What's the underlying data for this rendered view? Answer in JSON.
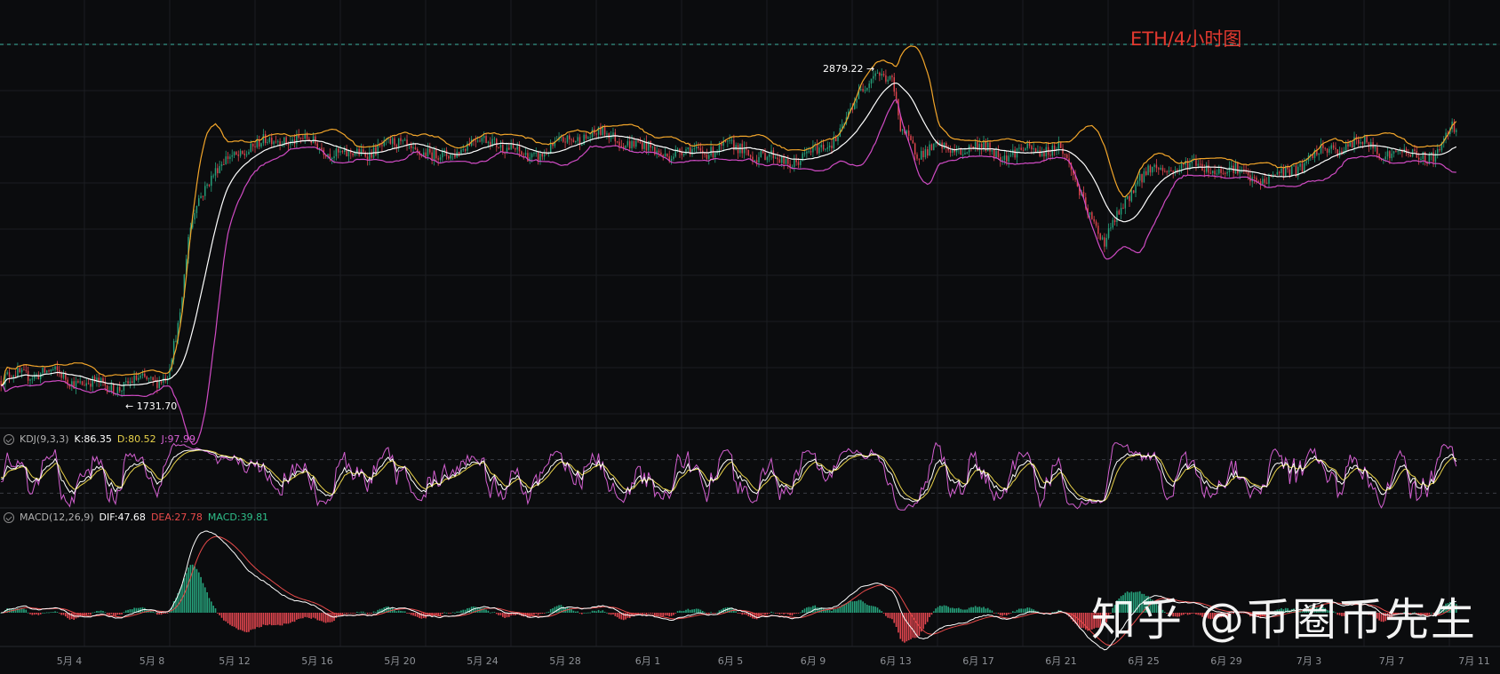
{
  "title": "ETH/4小时图",
  "watermark": "知乎 @币圈币先生",
  "price_high_label": "2879.22",
  "price_low_label": "1731.70",
  "kdj": {
    "name": "KDJ(9,3,3)",
    "k": "K:86.35",
    "d": "D:80.52",
    "j": "J:97.99"
  },
  "macd": {
    "name": "MACD(12,26,9)",
    "dif": "DIF:47.68",
    "dea": "DEA:27.78",
    "macd": "MACD:39.81"
  },
  "colors": {
    "up": "#26a17b",
    "down": "#e0454e",
    "upper_band": "#f2a52a",
    "lower_band": "#d04bc4",
    "mid_band": "#ffffff",
    "k": "#ffffff",
    "d": "#e8d24a",
    "j": "#d35fd0",
    "dif": "#ffffff",
    "dea": "#e84a4a"
  },
  "chart_data": {
    "type": "line",
    "x_tick_labels": [
      "5月 4",
      "5月 8",
      "5月 12",
      "5月 16",
      "5月 20",
      "5月 24",
      "5月 28",
      "6月 1",
      "6月 5",
      "6月 9",
      "6月 13",
      "6月 17",
      "6月 21",
      "6月 25",
      "6月 29",
      "7月 3",
      "7月 7",
      "7月 11"
    ],
    "price_keypoints": [
      [
        0,
        1790
      ],
      [
        16,
        1800
      ],
      [
        30,
        1795
      ],
      [
        46,
        1790
      ],
      [
        62,
        1792
      ],
      [
        74,
        1788
      ],
      [
        80,
        1800
      ],
      [
        86,
        1950
      ],
      [
        90,
        2200
      ],
      [
        94,
        2320
      ],
      [
        100,
        2380
      ],
      [
        110,
        2460
      ],
      [
        120,
        2500
      ],
      [
        134,
        2520
      ],
      [
        150,
        2480
      ],
      [
        166,
        2440
      ],
      [
        180,
        2490
      ],
      [
        194,
        2510
      ],
      [
        208,
        2450
      ],
      [
        222,
        2470
      ],
      [
        236,
        2500
      ],
      [
        250,
        2460
      ],
      [
        262,
        2490
      ],
      [
        278,
        2520
      ],
      [
        294,
        2500
      ],
      [
        310,
        2470
      ],
      [
        326,
        2480
      ],
      [
        340,
        2490
      ],
      [
        356,
        2470
      ],
      [
        364,
        2440
      ],
      [
        378,
        2430
      ],
      [
        392,
        2480
      ],
      [
        402,
        2540
      ],
      [
        412,
        2640
      ],
      [
        420,
        2720
      ],
      [
        428,
        2660
      ],
      [
        432,
        2520
      ],
      [
        440,
        2460
      ],
      [
        452,
        2470
      ],
      [
        466,
        2500
      ],
      [
        480,
        2480
      ],
      [
        494,
        2460
      ],
      [
        508,
        2470
      ],
      [
        512,
        2420
      ],
      [
        522,
        2300
      ],
      [
        530,
        2200
      ],
      [
        536,
        2290
      ],
      [
        544,
        2390
      ],
      [
        552,
        2420
      ],
      [
        560,
        2420
      ],
      [
        576,
        2410
      ],
      [
        592,
        2410
      ],
      [
        608,
        2400
      ],
      [
        620,
        2430
      ],
      [
        636,
        2460
      ],
      [
        652,
        2480
      ],
      [
        670,
        2470
      ],
      [
        682,
        2480
      ],
      [
        690,
        2470
      ],
      [
        696,
        2540
      ]
    ],
    "series": [
      {
        "name": "K",
        "values": []
      },
      {
        "name": "D",
        "values": []
      },
      {
        "name": "J",
        "values": []
      }
    ],
    "grid": true
  }
}
